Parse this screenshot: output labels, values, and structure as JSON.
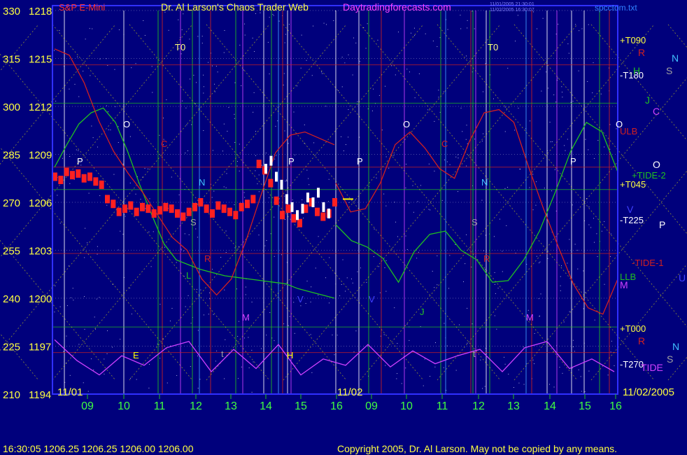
{
  "header": {
    "symbol": "S&P E-Mini",
    "title": "Dr. Al Larson's Chaos Trader Web",
    "site": "Daytradingforecasts.com",
    "stamp1": "11/01/2005 21:30:01",
    "stamp2": "11/02/2005 16:30:07",
    "file": "spcctom.txt"
  },
  "footer": {
    "quote": "16:30:05  1206.25 1206.25 1206.00 1206.00",
    "copyright": "Copyright 2005, Dr. Al Larson. May not be copied by any means."
  },
  "colors": {
    "background": "#00007c",
    "frame": "#3030ff",
    "price_bars": "#ff2020",
    "late_bars": "#ffffff",
    "yellow": "#ffff00",
    "green_curve": "#20c020",
    "red_curve": "#d02020",
    "magenta_curve": "#d040ff",
    "hour_tick": "#20c020"
  },
  "chart_data": {
    "type": "line",
    "y_axis": {
      "angles": [
        "330",
        "315",
        "300",
        "285",
        "270",
        "255",
        "240",
        "225",
        "210"
      ],
      "prices": [
        "1218",
        "1215",
        "1212",
        "1209",
        "1206",
        "1203",
        "1200",
        "1197",
        "1194"
      ],
      "ylim": [
        1194,
        1218
      ]
    },
    "x_axis": {
      "hour_labels": [
        "09",
        "10",
        "11",
        "12",
        "13",
        "14",
        "15",
        "16",
        "09",
        "10",
        "11",
        "12",
        "13",
        "14",
        "15",
        "16"
      ],
      "date_labels": [
        "11/01",
        "11/02",
        "11/02/2005"
      ]
    },
    "right_labels": [
      "+T090",
      "-T180",
      "+T045",
      "-T225",
      "+T000",
      "-T270",
      "ULB",
      "+TIDE-2",
      "-TIDE-1",
      "LLB"
    ],
    "planet_marks": [
      "T0",
      "T0",
      "O",
      "O",
      "O",
      "P",
      "P",
      "P",
      "P",
      "C",
      "C",
      "N",
      "N",
      "S",
      "S",
      "R",
      "R",
      "M",
      "M",
      "V",
      "V",
      "J",
      "H",
      "E",
      "t",
      "t",
      "L"
    ],
    "legend_marks": [
      "R",
      "N",
      "S",
      "H",
      "J",
      "C",
      "O",
      "P",
      "V",
      "M",
      "R",
      "N",
      "S",
      "U",
      "TIDE"
    ],
    "price_series": {
      "name": "S&P E-Mini 1-min",
      "close": [
        1207.6,
        1207.4,
        1207.9,
        1207.7,
        1207.8,
        1207.5,
        1207.6,
        1207.3,
        1207.1,
        1206.2,
        1205.9,
        1205.4,
        1205.6,
        1205.8,
        1205.4,
        1205.7,
        1205.6,
        1205.3,
        1205.5,
        1205.7,
        1205.6,
        1205.3,
        1205.1,
        1205.4,
        1205.7,
        1206.0,
        1205.6,
        1205.3,
        1205.8,
        1205.6,
        1205.4,
        1205.2,
        1205.7,
        1205.9,
        1206.2,
        1208.4,
        1208.0,
        1207.2,
        1206.1,
        1205.2,
        1205.6,
        1205.0,
        1204.7,
        1205.6,
        1206.0,
        1205.4,
        1205.1,
        1205.3,
        1206.0
      ],
      "late_segment": [
        1208.1,
        1208.6,
        1207.6,
        1207.1,
        1206.2,
        1205.7,
        1205.2,
        1205.6,
        1206.3,
        1206.0,
        1206.6,
        1205.7,
        1205.3
      ]
    },
    "cycle_curves": {
      "green": [
        1208.2,
        1209.6,
        1210.9,
        1211.6,
        1211.9,
        1211.0,
        1209.2,
        1207.1,
        1205.2,
        1203.4,
        1202.4,
        1202.1,
        1201.8,
        1201.6,
        1201.4,
        1201.3,
        1201.2,
        1201.1,
        1201.0,
        1200.9,
        1200.6,
        1200.4,
        1200.2,
        1200.0
      ],
      "green_day2": [
        1204.6,
        1203.6,
        1203.2,
        1202.5,
        1201.0,
        1202.9,
        1204.0,
        1204.2,
        1203.0,
        1202.4,
        1201.0,
        1201.1,
        1202.4,
        1204.2,
        1206.6,
        1209.2,
        1211.0,
        1210.4,
        1207.9
      ],
      "red": [
        1215.6,
        1215.2,
        1213.5,
        1211.1,
        1209.2,
        1207.8,
        1206.6,
        1205.2,
        1203.8,
        1203.0,
        1201.2,
        1200.2,
        1201.2,
        1203.6,
        1206.4,
        1209.1,
        1210.2,
        1210.4,
        1210.0,
        1209.6
      ],
      "red_day2": [
        1207.2,
        1205.4,
        1205.6,
        1207.2,
        1209.6,
        1210.4,
        1209.4,
        1208.1,
        1207.5,
        1209.8,
        1211.6,
        1211.8,
        1211.0,
        1208.2,
        1205.6,
        1203.2,
        1200.9,
        1199.4,
        1199.0,
        1201.2
      ],
      "magenta": [
        1197.4,
        1196.1,
        1195.2,
        1196.4,
        1195.8,
        1196.9,
        1197.3,
        1195.4,
        1196.8,
        1195.6,
        1197.1,
        1195.2,
        1196.2,
        1195.8,
        1197.1,
        1195.7,
        1196.7,
        1195.9,
        1196.4,
        1196.8,
        1195.4,
        1196.9,
        1197.3,
        1195.6,
        1196.2,
        1195.4
      ]
    },
    "price_lines": [
      1214.6,
      1212.2,
      1208.2,
      1206.8,
      1202.8,
      1198.2,
      1196.6
    ]
  }
}
